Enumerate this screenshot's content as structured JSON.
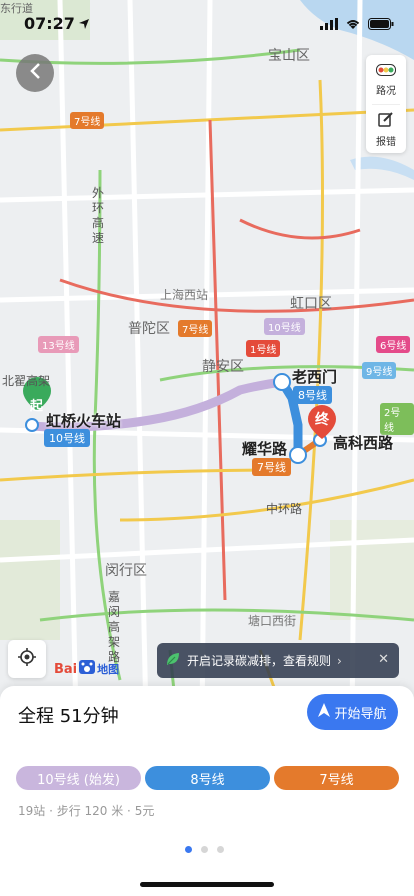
{
  "status": {
    "time": "07:27"
  },
  "toolbar": {
    "traffic_label": "路况",
    "report_label": "报错"
  },
  "map": {
    "districts": [
      {
        "text": "宝山区"
      },
      {
        "text": "普陀区"
      },
      {
        "text": "静安区"
      },
      {
        "text": "虹口区"
      },
      {
        "text": "闵行区"
      },
      {
        "text": "北翟高架"
      },
      {
        "text": "上海西站"
      },
      {
        "text": "外环高速"
      },
      {
        "text": "中环路"
      },
      {
        "text": "嘉闵高架路"
      },
      {
        "text": "塘口西街"
      },
      {
        "text": "东行道"
      }
    ],
    "line_badges": [
      "7号线",
      "10号线",
      "13号线",
      "7号线",
      "1号线",
      "6号线",
      "9号线",
      "2号线"
    ],
    "stations": {
      "start_marker": "起",
      "end_marker": "终",
      "hongqiao": "虹桥火车站",
      "laoximen": "老西门",
      "yaohualu": "耀华路",
      "gaokexilu": "高科西路"
    },
    "route_badges": {
      "line10": "10号线",
      "line8": "8号线",
      "line7": "7号线"
    }
  },
  "logo": {
    "brand": "Bai",
    "brand_suffix": "地图"
  },
  "banner": {
    "text": "开启记录碳减排，查看规则",
    "chevron": "›"
  },
  "sheet": {
    "total": "全程 51分钟",
    "nav_button": "开始导航",
    "lines": [
      {
        "label": "10号线 (始发)",
        "color": "#c9b6dd"
      },
      {
        "label": "8号线",
        "color": "#3d8fdd"
      },
      {
        "label": "7号线",
        "color": "#e47a2c"
      }
    ],
    "summary": "19站 · 步行 120 米 · 5元",
    "page_index": 1,
    "page_count": 3
  },
  "colors": {
    "line10": "#c4b0dc",
    "line8": "#3d8fdd",
    "line7": "#e47a2c",
    "start": "#3aaa5c",
    "end": "#e44b3a",
    "accent": "#3a78f0"
  }
}
